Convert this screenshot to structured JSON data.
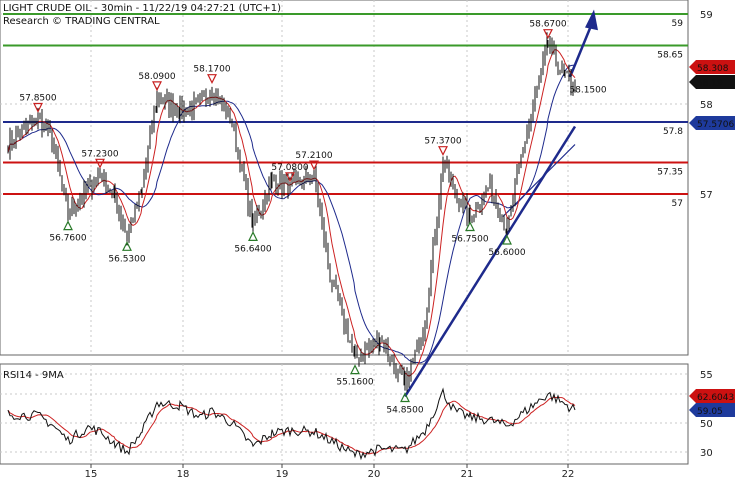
{
  "header": {
    "title": "LIGHT CRUDE OIL - 30min - 11/22/19 04:27:21 (UTC+1)",
    "subtitle": "Research © TRADING CENTRAL"
  },
  "colors": {
    "price": "#111111",
    "ma_fast": "#cc2222",
    "ma_slow": "#1e2a8c",
    "support": "#cc1111",
    "resistance_green": "#3a9a2a",
    "pivot": "#1e2a8c",
    "trend": "#1e2a8c",
    "marker_up": "#2a7a2a",
    "marker_down": "#c82020",
    "rsi": "#111111",
    "rsi_ma": "#cc2222",
    "badge_red": "#cc1111",
    "badge_black": "#111111",
    "badge_blue": "#1e3a9c"
  },
  "chart_data": [
    {
      "type": "line",
      "title": "LIGHT CRUDE OIL - 30min - 11/22/19 04:27:21 (UTC+1)",
      "x_ticks": [
        "15",
        "18",
        "19",
        "20",
        "21",
        "22"
      ],
      "y_ticks": [
        55,
        57,
        58,
        59
      ],
      "ylim": [
        54.5,
        59.1
      ],
      "price_path": [
        [
          "15-a",
          57.55
        ],
        [
          "15-b",
          57.85
        ],
        [
          "15-c",
          57.6
        ],
        [
          "15-d",
          56.76
        ],
        [
          "15-e",
          57.05
        ],
        [
          "15-f",
          57.23
        ],
        [
          "15-g",
          56.95
        ],
        [
          "18-a",
          56.53
        ],
        [
          "18-b",
          57.05
        ],
        [
          "18-c",
          58.09
        ],
        [
          "18-d",
          57.92
        ],
        [
          "18-e",
          58.0
        ],
        [
          "18-f",
          58.17
        ],
        [
          "18-g",
          57.8
        ],
        [
          "19-a",
          56.64
        ],
        [
          "19-b",
          57.15
        ],
        [
          "19-c",
          57.08
        ],
        [
          "19-d",
          57.21
        ],
        [
          "19-e",
          56.1
        ],
        [
          "19-f",
          55.16
        ],
        [
          "20-a",
          55.4
        ],
        [
          "20-b",
          54.85
        ],
        [
          "20-c",
          55.6
        ],
        [
          "20-d",
          57.37
        ],
        [
          "20-e",
          57.0
        ],
        [
          "21-a",
          56.75
        ],
        [
          "21-b",
          57.1
        ],
        [
          "21-c",
          56.6
        ],
        [
          "21-d",
          57.6
        ],
        [
          "21-e",
          58.67
        ],
        [
          "21-f",
          58.3
        ],
        [
          "22-a",
          58.19
        ]
      ],
      "horizontal_levels": [
        {
          "label": "59",
          "value": 59.0,
          "style": "green"
        },
        {
          "label": "58.65",
          "value": 58.65,
          "style": "green"
        },
        {
          "label": "57.8",
          "value": 57.8,
          "style": "blue"
        },
        {
          "label": "57.35",
          "value": 57.35,
          "style": "red"
        },
        {
          "label": "57",
          "value": 57.0,
          "style": "red"
        }
      ],
      "annotations_high": [
        {
          "label": "57.8500",
          "value": 57.85
        },
        {
          "label": "57.2300",
          "value": 57.23
        },
        {
          "label": "58.0900",
          "value": 58.09
        },
        {
          "label": "58.1700",
          "value": 58.17
        },
        {
          "label": "57.0800",
          "value": 57.08
        },
        {
          "label": "57.2100",
          "value": 57.21
        },
        {
          "label": "57.3700",
          "value": 57.37
        },
        {
          "label": "58.6700",
          "value": 58.67
        }
      ],
      "annotations_low": [
        {
          "label": "56.7600",
          "value": 56.76
        },
        {
          "label": "56.5300",
          "value": 56.53
        },
        {
          "label": "56.6400",
          "value": 56.64
        },
        {
          "label": "55.1600",
          "value": 55.16
        },
        {
          "label": "54.8500",
          "value": 54.85
        },
        {
          "label": "56.7500",
          "value": 56.75
        },
        {
          "label": "56.6000",
          "value": 56.6
        }
      ],
      "extra_label": {
        "label": "58.1500",
        "value": 58.15
      },
      "price_badges": [
        {
          "label": "58.308",
          "value": 58.308,
          "style": "red"
        },
        {
          "label": "58.19",
          "value": 58.19,
          "style": "black"
        },
        {
          "label": "57.5706",
          "value": 57.5706,
          "style": "blue"
        }
      ],
      "legend": "none"
    },
    {
      "type": "line",
      "title": "RSI14 - 9MA",
      "y_ticks": [
        30,
        50
      ],
      "ylim": [
        25,
        75
      ],
      "rsi_path": [
        [
          "15-a",
          56
        ],
        [
          "15-b",
          55
        ],
        [
          "15-c",
          49
        ],
        [
          "15-d",
          38
        ],
        [
          "15-e",
          47
        ],
        [
          "15-f",
          44
        ],
        [
          "15-g",
          36
        ],
        [
          "18-a",
          30
        ],
        [
          "18-b",
          44
        ],
        [
          "18-c",
          64
        ],
        [
          "18-d",
          62
        ],
        [
          "18-e",
          54
        ],
        [
          "18-f",
          58
        ],
        [
          "18-g",
          50
        ],
        [
          "19-a",
          34
        ],
        [
          "19-b",
          43
        ],
        [
          "19-c",
          45
        ],
        [
          "19-d",
          44
        ],
        [
          "19-e",
          38
        ],
        [
          "19-f",
          28
        ],
        [
          "20-a",
          32
        ],
        [
          "20-b",
          31
        ],
        [
          "20-c",
          45
        ],
        [
          "20-d",
          71
        ],
        [
          "20-e",
          58
        ],
        [
          "21-a",
          54
        ],
        [
          "21-b",
          52
        ],
        [
          "21-c",
          48
        ],
        [
          "21-d",
          58
        ],
        [
          "21-e",
          70
        ],
        [
          "21-f",
          63
        ],
        [
          "22-a",
          59
        ]
      ],
      "rsi_badges": [
        {
          "label": "62.6043",
          "value": 62.6043,
          "style": "red"
        },
        {
          "label": "59.05",
          "value": 59.05,
          "style": "blue"
        }
      ]
    }
  ]
}
